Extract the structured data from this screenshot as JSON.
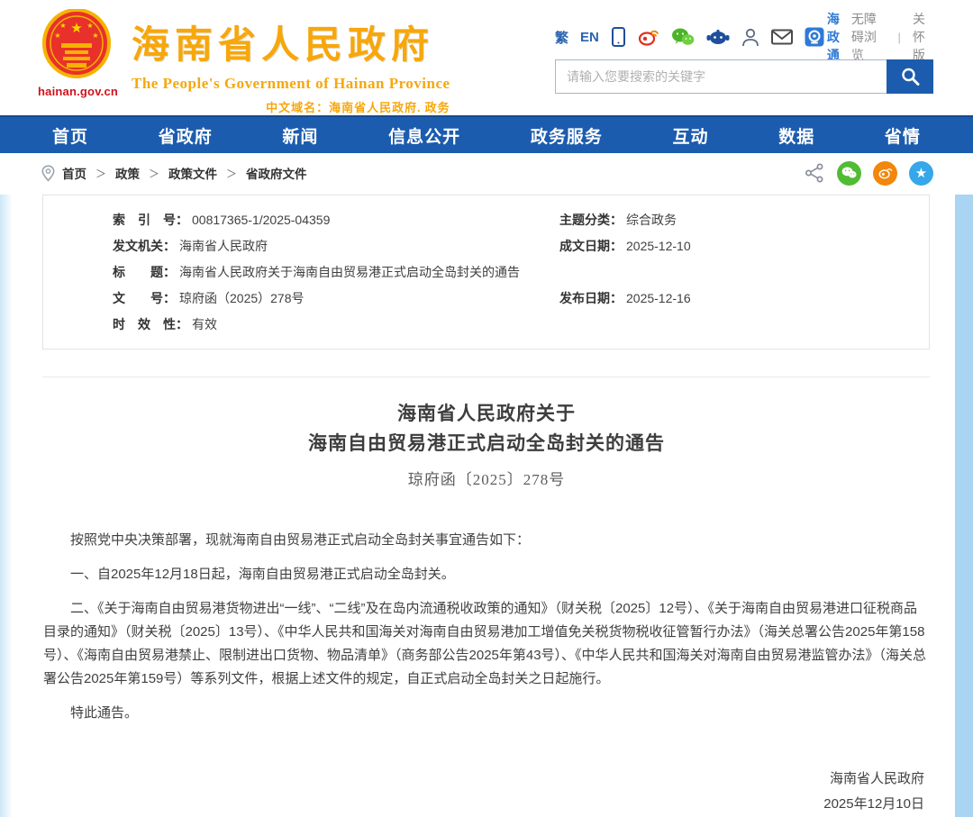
{
  "header": {
    "logo_domain": "hainan.gov.cn",
    "site_title": "海南省人民政府",
    "site_title_en": "The People's Government  of Hainan Province",
    "site_domain_line": "中文域名：海南省人民政府. 政务",
    "quick_links": {
      "traditional": "繁",
      "english": "EN",
      "hzt_label": "海政通",
      "accessibility": "无障碍浏览",
      "separator": "|",
      "care_version": "关怀版"
    },
    "search": {
      "placeholder": "请输入您要搜索的关键字"
    }
  },
  "nav": {
    "items": [
      "首页",
      "省政府",
      "新闻",
      "信息公开",
      "政务服务",
      "互动",
      "数据",
      "省情"
    ]
  },
  "breadcrumb": {
    "separator": "＞",
    "items": [
      "首页",
      "政策",
      "政策文件",
      "省政府文件"
    ]
  },
  "meta_table": {
    "rows": [
      {
        "left_label": "索　引　号：",
        "left_value": "00817365-1/2025-04359",
        "right_label": "主题分类：",
        "right_value": "综合政务"
      },
      {
        "left_label": "发文机关：",
        "left_value": "海南省人民政府",
        "right_label": "成文日期：",
        "right_value": "2025-12-10"
      },
      {
        "left_label": "标　　题：",
        "left_value": "海南省人民政府关于海南自由贸易港正式启动全岛封关的通告",
        "right_label": "",
        "right_value": ""
      },
      {
        "left_label": "文　　号：",
        "left_value": "琼府函（2025）278号",
        "right_label": "发布日期：",
        "right_value": "2025-12-16"
      },
      {
        "left_label": "时　效　性：",
        "left_value": "有效",
        "right_label": "",
        "right_value": ""
      }
    ]
  },
  "document": {
    "title_line1": "海南省人民政府关于",
    "title_line2": "海南自由贸易港正式启动全岛封关的通告",
    "doc_number": "琼府函〔2025〕278号",
    "paragraphs": [
      "按照党中央决策部署，现就海南自由贸易港正式启动全岛封关事宜通告如下：",
      "一、自2025年12月18日起，海南自由贸易港正式启动全岛封关。",
      "二、《关于海南自由贸易港货物进出“一线”、“二线”及在岛内流通税收政策的通知》（财关税〔2025〕12号）、《关于海南自由贸易港进口征税商品目录的通知》（财关税〔2025〕13号）、《中华人民共和国海关对海南自由贸易港加工增值免关税货物税收征管暂行办法》（海关总署公告2025年第158号）、《海南自由贸易港禁止、限制进出口货物、物品清单》（商务部公告2025年第43号）、《中华人民共和国海关对海南自由贸易港监管办法》（海关总署公告2025年第159号）等系列文件，根据上述文件的规定，自正式启动全岛封关之日起施行。",
      "特此通告。"
    ],
    "signature": {
      "issuer": "海南省人民政府",
      "date": "2025年12月10日"
    }
  },
  "colors": {
    "nav_blue": "#1c5cae",
    "title_gold": "#f7a70c",
    "emblem_red": "#e8312a",
    "wechat_green": "#52bb34",
    "weibo_orange": "#f2870c",
    "qzone_blue": "#36a7e9",
    "link_blue": "#2a63b0"
  }
}
